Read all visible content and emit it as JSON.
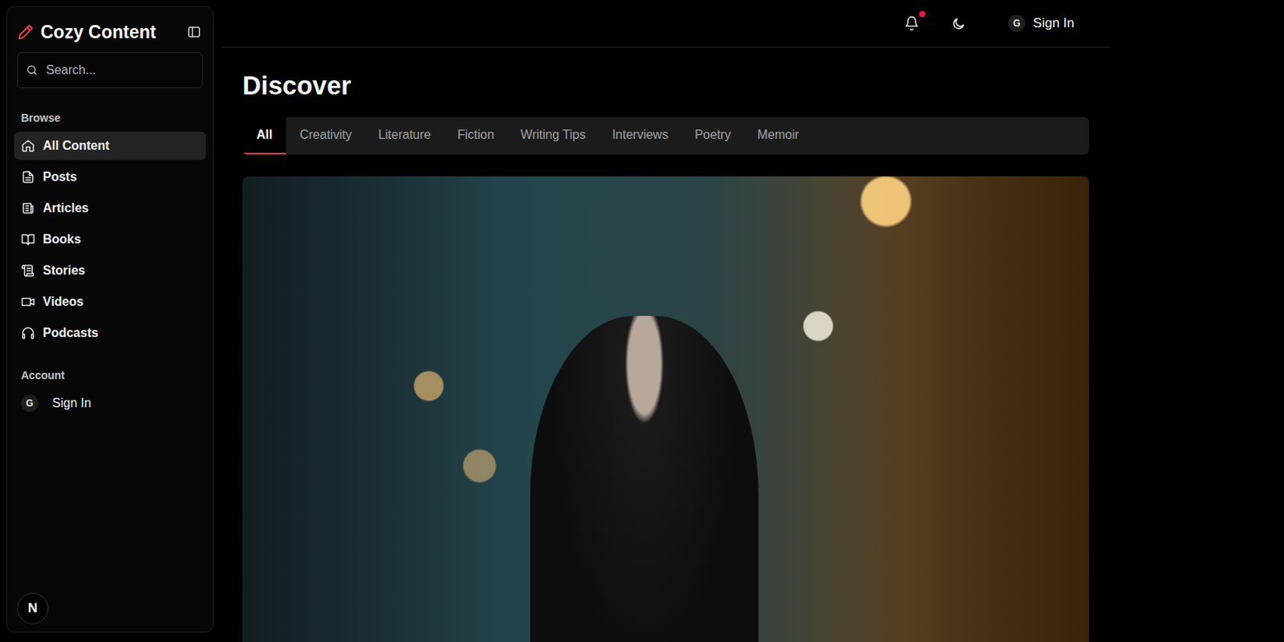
{
  "app": {
    "name": "Cozy Content"
  },
  "search": {
    "placeholder": "Search..."
  },
  "sidebar": {
    "sections": [
      {
        "title": "Browse",
        "items": [
          {
            "label": "All Content",
            "selected": true
          },
          {
            "label": "Posts",
            "selected": false
          },
          {
            "label": "Articles",
            "selected": false
          },
          {
            "label": "Books",
            "selected": false
          },
          {
            "label": "Stories",
            "selected": false
          },
          {
            "label": "Videos",
            "selected": false
          },
          {
            "label": "Podcasts",
            "selected": false
          }
        ]
      },
      {
        "title": "Account",
        "items": [
          {
            "label": "Sign In",
            "avatar": "G",
            "selected": false
          }
        ]
      }
    ]
  },
  "header": {
    "notifications": {
      "unread": true
    },
    "sign_in": {
      "avatar": "G",
      "label": "Sign In"
    }
  },
  "page": {
    "title": "Discover"
  },
  "tabs": [
    {
      "label": "All",
      "selected": true
    },
    {
      "label": "Creativity",
      "selected": false
    },
    {
      "label": "Literature",
      "selected": false
    },
    {
      "label": "Fiction",
      "selected": false
    },
    {
      "label": "Writing Tips",
      "selected": false
    },
    {
      "label": "Interviews",
      "selected": false
    },
    {
      "label": "Poetry",
      "selected": false
    },
    {
      "label": "Memoir",
      "selected": false
    }
  ],
  "dev_indicator": {
    "label": "N"
  }
}
